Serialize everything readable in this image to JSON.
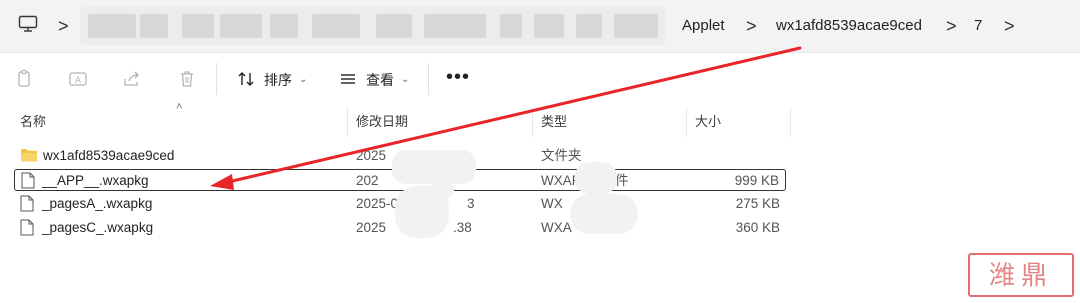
{
  "address_bar": {
    "crumbs": [
      "Applet",
      "wx1afd8539acae9ced",
      "7"
    ],
    "separator": ">"
  },
  "toolbar": {
    "sort_label": "排序",
    "view_label": "查看",
    "more_label": "•••",
    "icons": [
      "copy-icon",
      "rename-icon",
      "share-icon",
      "delete-icon",
      "sort-icon",
      "view-icon"
    ]
  },
  "columns": {
    "name": "名称",
    "modified": "修改日期",
    "type": "类型",
    "size": "大小"
  },
  "files": [
    {
      "name": "wx1afd8539acae9ced",
      "modified": "2025",
      "type": "文件夹",
      "size": "",
      "kind": "folder"
    },
    {
      "name": "__APP__.wxapkg",
      "modified": "202",
      "type": "WXAP",
      "type_suffix": "件",
      "size": "999 KB",
      "kind": "file",
      "selected": true
    },
    {
      "name": "_pagesA_.wxapkg",
      "modified": "2025-0",
      "modified_suffix": "3",
      "type": "WX",
      "size": "275 KB",
      "kind": "file"
    },
    {
      "name": "_pagesC_.wxapkg",
      "modified": "2025",
      "modified_suffix": ".38",
      "type": "WXA",
      "size": "360 KB",
      "kind": "file"
    }
  ],
  "colors": {
    "arrow": "#e8262a",
    "selection_border": "#333333",
    "folder": "#f4c542",
    "stamp": "#e07070"
  },
  "watermark": "潍鼎"
}
